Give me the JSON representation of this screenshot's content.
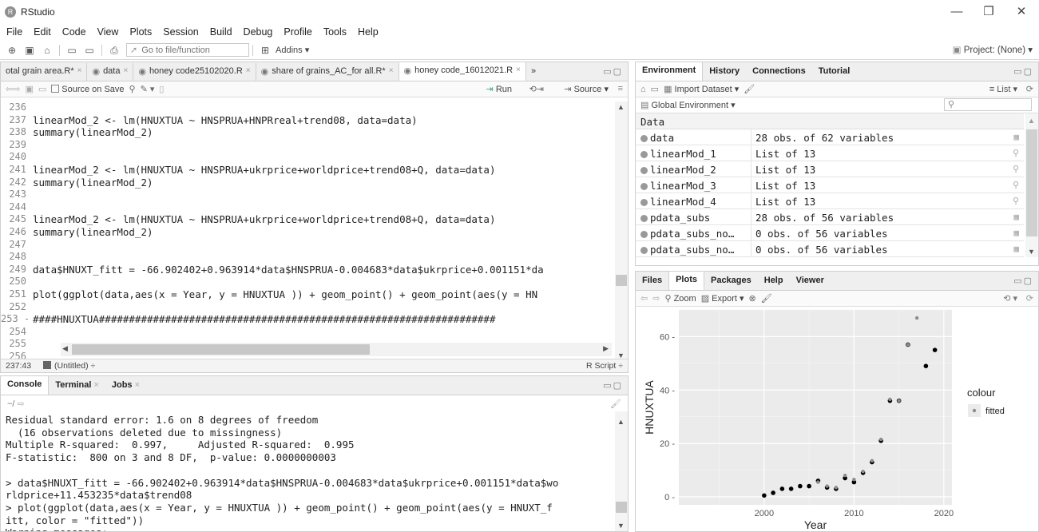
{
  "app": {
    "title": "RStudio",
    "minimize": "—",
    "maximize": "❐",
    "close": "✕"
  },
  "menu": [
    "File",
    "Edit",
    "Code",
    "View",
    "Plots",
    "Session",
    "Build",
    "Debug",
    "Profile",
    "Tools",
    "Help"
  ],
  "toolbar": {
    "goto_placeholder": "Go to file/function",
    "addins": "Addins",
    "project": "Project: (None)"
  },
  "editor": {
    "tabs": [
      {
        "label": "otal grain area.R*",
        "active": false
      },
      {
        "label": "data",
        "active": false
      },
      {
        "label": "honey code25102020.R",
        "active": false
      },
      {
        "label": "share of grains_AC_for all.R*",
        "active": false
      },
      {
        "label": "honey code_16012021.R",
        "active": true
      }
    ],
    "more": "»",
    "source_on_save": "Source on Save",
    "run": "Run",
    "source": "Source",
    "lines": [
      {
        "n": "236",
        "code": ""
      },
      {
        "n": "237",
        "code": "linearMod_2 <- lm(HNUXTUA ~ HNSPRUA+HNPRreal+trend08, data=data)"
      },
      {
        "n": "238",
        "code": "summary(linearMod_2)"
      },
      {
        "n": "239",
        "code": ""
      },
      {
        "n": "240",
        "code": ""
      },
      {
        "n": "241",
        "code": "linearMod_2 <- lm(HNUXTUA ~ HNSPRUA+ukrprice+worldprice+trend08+Q, data=data)"
      },
      {
        "n": "242",
        "code": "summary(linearMod_2)"
      },
      {
        "n": "243",
        "code": ""
      },
      {
        "n": "244",
        "code": ""
      },
      {
        "n": "245",
        "code": "linearMod_2 <- lm(HNUXTUA ~ HNSPRUA+ukrprice+worldprice+trend08+Q, data=data)"
      },
      {
        "n": "246",
        "code": "summary(linearMod_2)"
      },
      {
        "n": "247",
        "code": ""
      },
      {
        "n": "248",
        "code": ""
      },
      {
        "n": "249",
        "code": "data$HNUXT_fitt = -66.902402+0.963914*data$HNSPRUA-0.004683*data$ukrprice+0.001151*da"
      },
      {
        "n": "250",
        "code": ""
      },
      {
        "n": "251",
        "code": "plot(ggplot(data,aes(x = Year, y = HNUXTUA )) + geom_point() + geom_point(aes(y = HN"
      },
      {
        "n": "252",
        "code": ""
      },
      {
        "n": "253 -",
        "code": "####HNUXTUA##################################################################"
      },
      {
        "n": "254",
        "code": ""
      },
      {
        "n": "255",
        "code": ""
      },
      {
        "n": "256",
        "code": ""
      }
    ],
    "status_pos": "237:43",
    "status_scope": "(Untitled) ÷",
    "status_type": "R Script ÷"
  },
  "console": {
    "tabs": [
      "Console",
      "Terminal",
      "Jobs"
    ],
    "path": "~/",
    "lines": [
      "Residual standard error: 1.6 on 8 degrees of freedom",
      "  (16 observations deleted due to missingness)",
      "Multiple R-squared:  0.997,\tAdjusted R-squared:  0.995",
      "F-statistic:  800 on 3 and 8 DF,  p-value: 0.0000000003",
      "",
      "> data$HNUXT_fitt = -66.902402+0.963914*data$HNSPRUA-0.004683*data$ukrprice+0.001151*data$wo",
      "rldprice+11.453235*data$trend08",
      "> plot(ggplot(data,aes(x = Year, y = HNUXTUA )) + geom_point() + geom_point(aes(y = HNUXT_f",
      "itt, color = \"fitted\"))",
      "Warning messages:"
    ]
  },
  "environment": {
    "tabs": [
      "Environment",
      "History",
      "Connections",
      "Tutorial"
    ],
    "import": "Import Dataset",
    "list": "List",
    "scope": "Global Environment",
    "section": "Data",
    "rows": [
      {
        "name": "data",
        "value": "28 obs. of 62 variables",
        "icon": "grid-icon"
      },
      {
        "name": "linearMod_1",
        "value": "List of 13",
        "icon": "search-icon"
      },
      {
        "name": "linearMod_2",
        "value": "List of 13",
        "icon": "search-icon"
      },
      {
        "name": "linearMod_3",
        "value": "List of 13",
        "icon": "search-icon"
      },
      {
        "name": "linearMod_4",
        "value": "List of 13",
        "icon": "search-icon"
      },
      {
        "name": "pdata_subs",
        "value": "28 obs. of 56 variables",
        "icon": "grid-icon"
      },
      {
        "name": "pdata_subs_no…",
        "value": "0 obs. of 56 variables",
        "icon": "grid-icon"
      },
      {
        "name": "pdata_subs_no…",
        "value": "0 obs. of 56 variables",
        "icon": "grid-icon"
      }
    ]
  },
  "plots_pane": {
    "tabs": [
      "Files",
      "Plots",
      "Packages",
      "Help",
      "Viewer"
    ],
    "active_tab": "Plots",
    "zoom": "Zoom",
    "export": "Export"
  },
  "chart_data": {
    "type": "scatter",
    "title": "",
    "xlabel": "Year",
    "ylabel": "HNUXTUA",
    "xlim": [
      1990.5,
      2020.9
    ],
    "ylim": [
      -3,
      70
    ],
    "xticks": [
      2000,
      2010,
      2020
    ],
    "yticks": [
      0,
      20,
      40,
      60
    ],
    "grid": true,
    "legend": {
      "title": "colour",
      "entries": [
        "fitted"
      ],
      "placement": "right"
    },
    "series": [
      {
        "name": "observed",
        "color": "#000000",
        "x": [
          2000,
          2001,
          2002,
          2003,
          2004,
          2005,
          2006,
          2007,
          2008,
          2009,
          2010,
          2011,
          2012,
          2013,
          2014,
          2015,
          2016,
          2018,
          2019
        ],
        "y": [
          0.5,
          1.5,
          3,
          3,
          4,
          4,
          6,
          3.5,
          3,
          7,
          5.5,
          9,
          13,
          21,
          36,
          36,
          57,
          49,
          55
        ]
      },
      {
        "name": "fitted",
        "color": "#8c8c8c",
        "x": [
          2006,
          2007,
          2008,
          2009,
          2010,
          2011,
          2012,
          2013,
          2014,
          2015,
          2016,
          2017
        ],
        "y": [
          5.5,
          4,
          3.5,
          8,
          6.5,
          9.5,
          13.5,
          21.5,
          36.5,
          36,
          57,
          67
        ]
      }
    ]
  }
}
